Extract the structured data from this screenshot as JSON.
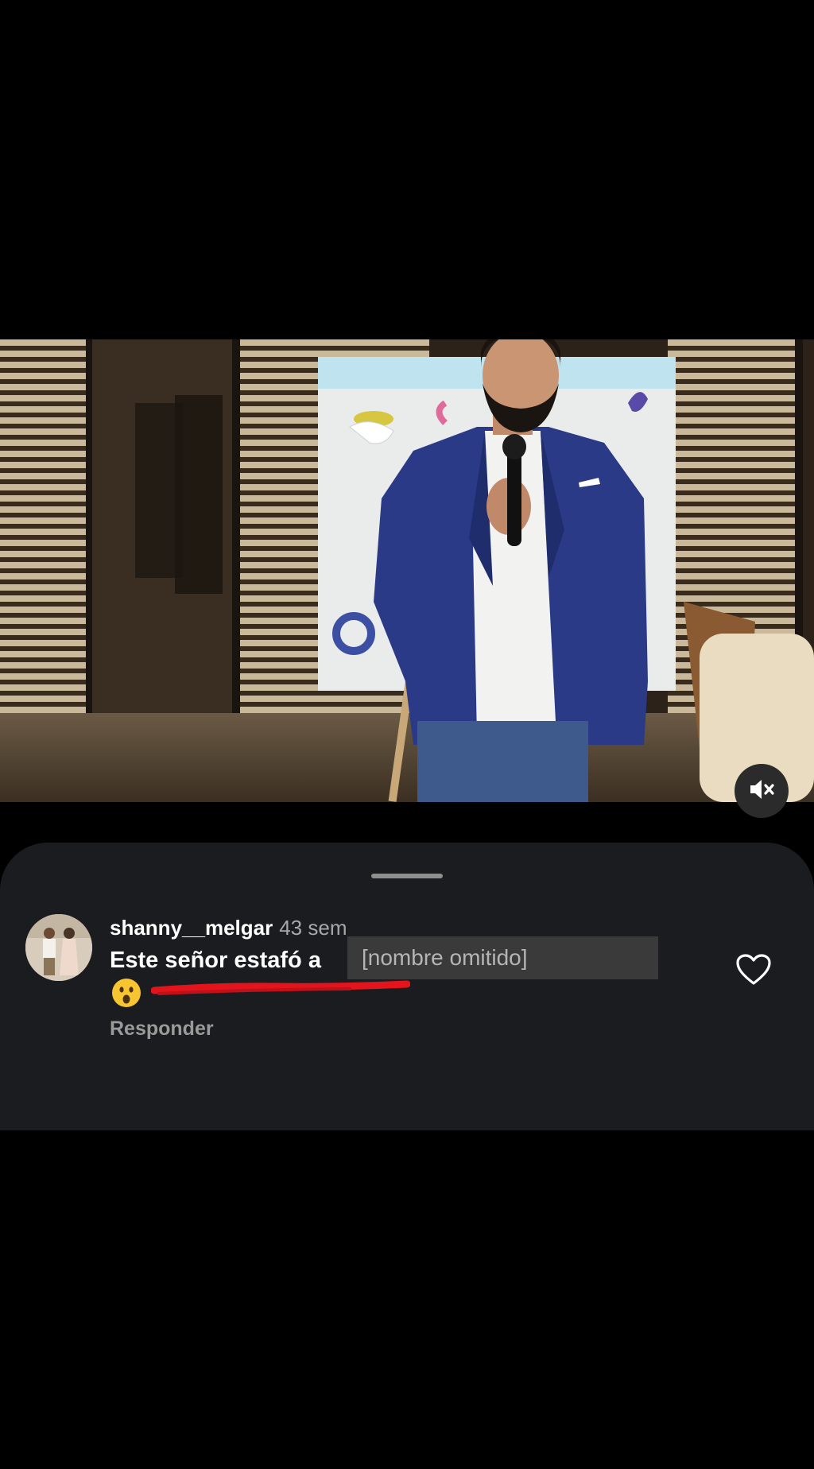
{
  "post": {
    "mute_icon": "speaker-muted-icon"
  },
  "comment_sheet": {
    "comment": {
      "username": "shanny__melgar",
      "timestamp": "43 sem",
      "text": "Este señor estafó a",
      "redacted_text": "[nombre omitido]",
      "emoji": "😮",
      "reply_label": "Responder",
      "like_icon": "heart-outline-icon"
    }
  },
  "colors": {
    "background": "#000000",
    "sheet": "#1a1c1f",
    "underline_mark": "#e3141c",
    "secondary_text": "#a8a8a8"
  }
}
